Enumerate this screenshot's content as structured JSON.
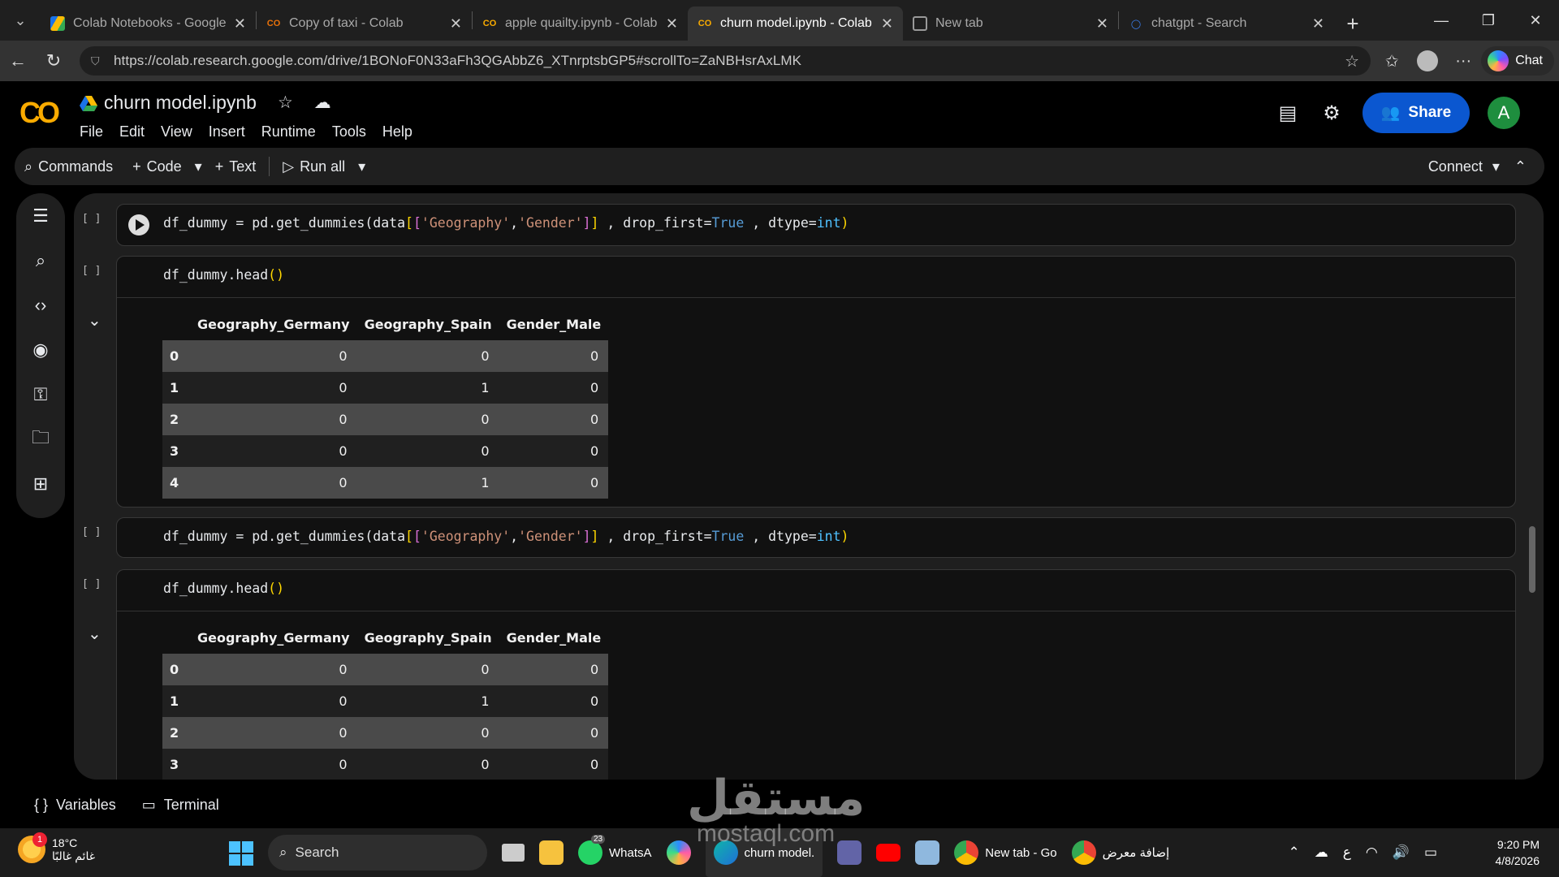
{
  "browser": {
    "tabs": [
      {
        "label": "Colab Notebooks - Google Drive",
        "icon": "google-drive-icon"
      },
      {
        "label": "Copy of taxi - Colab",
        "icon": "colab-icon"
      },
      {
        "label": "apple quailty.ipynb - Colab",
        "icon": "colab-icon"
      },
      {
        "label": "churn model.ipynb - Colab",
        "icon": "colab-icon",
        "active": true
      },
      {
        "label": "New tab",
        "icon": "new-tab-icon"
      },
      {
        "label": "chatgpt - Search",
        "icon": "search-icon"
      }
    ],
    "url": "https://colab.research.google.com/drive/1BONoF0N33aFh3QGAbbZ6_XTnrptsbGP5#scrollTo=ZaNBHsrAxLMK",
    "chat_label": "Chat"
  },
  "colab": {
    "logo": "CO",
    "filename": "churn model.ipynb",
    "menus": [
      "File",
      "Edit",
      "View",
      "Insert",
      "Runtime",
      "Tools",
      "Help"
    ],
    "share_label": "Share",
    "avatar_letter": "A",
    "toolbar": {
      "commands": "Commands",
      "code": "Code",
      "text": "Text",
      "run_all": "Run all",
      "connect": "Connect"
    },
    "bottom": {
      "variables": "Variables",
      "terminal": "Terminal"
    }
  },
  "cells": [
    {
      "bracket": "[ ]",
      "code": "df_dummy = pd.get_dummies(data[['Geography','Gender']] , drop_first=True , dtype=int)"
    },
    {
      "bracket": "[ ]",
      "code": "df_dummy.head()"
    },
    {
      "bracket": "[ ]",
      "code": "df_dummy = pd.get_dummies(data[['Geography','Gender']] , drop_first=True , dtype=int)"
    },
    {
      "bracket": "[ ]",
      "code": "df_dummy.head()"
    }
  ],
  "dataframe": {
    "columns": [
      "Geography_Germany",
      "Geography_Spain",
      "Gender_Male"
    ],
    "rows": [
      [
        "0",
        "0",
        "0",
        "0"
      ],
      [
        "1",
        "0",
        "1",
        "0"
      ],
      [
        "2",
        "0",
        "0",
        "0"
      ],
      [
        "3",
        "0",
        "0",
        "0"
      ],
      [
        "4",
        "0",
        "1",
        "0"
      ]
    ]
  },
  "taskbar": {
    "temperature": "18°C",
    "weather_text": "غائم غالبًا",
    "weather_badge": "1",
    "search": "Search",
    "whatsapp": "WhatsA",
    "whatsapp_badge": "23",
    "edge_label": "churn model.",
    "chrome_label": "New tab - Go",
    "chrome2_label": "إضافة معرض",
    "lang": "ع",
    "time": "9:20 PM",
    "date": "4/8/2026"
  },
  "watermark": {
    "arabic": "مستقل",
    "latin": "mostaql.com"
  }
}
